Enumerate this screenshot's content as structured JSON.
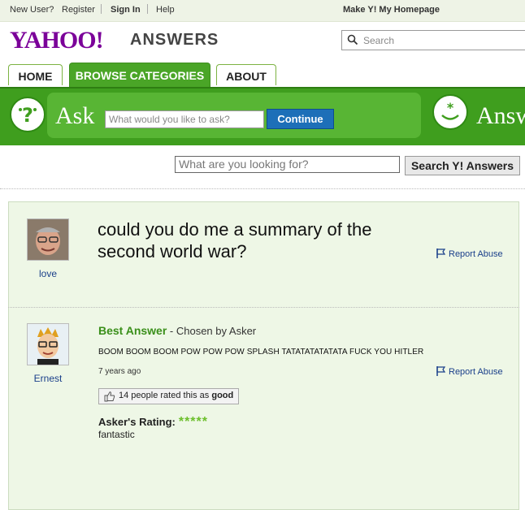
{
  "topbar": {
    "new_user": "New User?",
    "register": "Register",
    "sign_in": "Sign In",
    "help": "Help",
    "make_homepage": "Make Y! My Homepage"
  },
  "header": {
    "logo_text": "YAHOO!",
    "section_title": "ANSWERS",
    "search_placeholder": "Search"
  },
  "tabs": [
    {
      "label": "HOME"
    },
    {
      "label": "BROWSE CATEGORIES"
    },
    {
      "label": "ABOUT"
    }
  ],
  "askbar": {
    "ask_label": "Ask",
    "ask_placeholder": "What would you like to ask?",
    "continue_label": "Continue",
    "answer_label": "Answ"
  },
  "search": {
    "placeholder": "What are you looking for?",
    "button_label": "Search Y! Answers"
  },
  "question": {
    "asker": "love",
    "text": "could you do me a summary of the second world war?",
    "report": "Report Abuse"
  },
  "answer": {
    "answerer": "Ernest",
    "best_answer_label": "Best Answer",
    "chosen_by": " - Chosen by Asker",
    "text": "BOOM BOOM BOOM POW POW POW SPLASH TATATATATATATA  FUCK YOU HITLER",
    "time_ago": "7 years ago",
    "report": "Report Abuse",
    "rating_prefix": "14 people rated this as ",
    "rating_word": "good",
    "asker_rating_label": "Asker's Rating:",
    "stars": "*****",
    "asker_comment": "fantastic"
  },
  "colors": {
    "green": "#3f9e1e",
    "tab_active": "#4aa527",
    "yahoo_purple": "#7b0099",
    "link_blue": "#1a3f8a"
  }
}
